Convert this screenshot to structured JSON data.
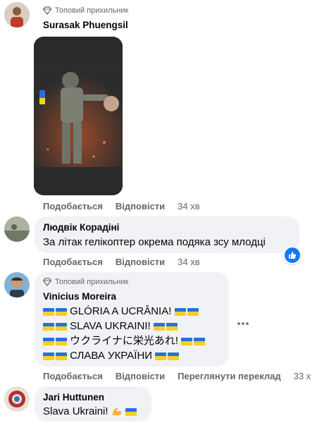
{
  "comments": [
    {
      "badge": "Топовий прихильник",
      "author": "Surasak Phuengsil",
      "actions": {
        "like": "Подобається",
        "reply": "Відповісти",
        "time": "34 хв"
      }
    },
    {
      "author": "Людвік Корадіні",
      "text": "За літак гелікоптер окрема подяка зсу млодці",
      "actions": {
        "like": "Подобається",
        "reply": "Відповісти",
        "time": "34 хв"
      }
    },
    {
      "badge": "Топовий прихильник",
      "author": "Vinicius Moreira",
      "lines": [
        "GLÓRIA A UCRÂNIA!",
        "SLAVA UKRAINI!",
        "ウクライナに栄光あれ!",
        "СЛАВА УКРАЇНИ"
      ],
      "actions": {
        "like": "Подобається",
        "reply": "Відповісти",
        "translate": "Переглянути переклад",
        "time": "33 х"
      }
    },
    {
      "author": "Jari Huttunen",
      "text": "Slava Ukraini!"
    }
  ],
  "icons": [
    "diamond-badge-icon",
    "like-reaction-icon",
    "more-options-icon",
    "ukraine-flag-icon",
    "flexed-biceps-icon"
  ],
  "colors": {
    "bubble": "#f0f2f5",
    "meta": "#65676b",
    "like": "#1877f2",
    "flag_blue": "#2a6fdb",
    "flag_yellow": "#f5d020"
  }
}
